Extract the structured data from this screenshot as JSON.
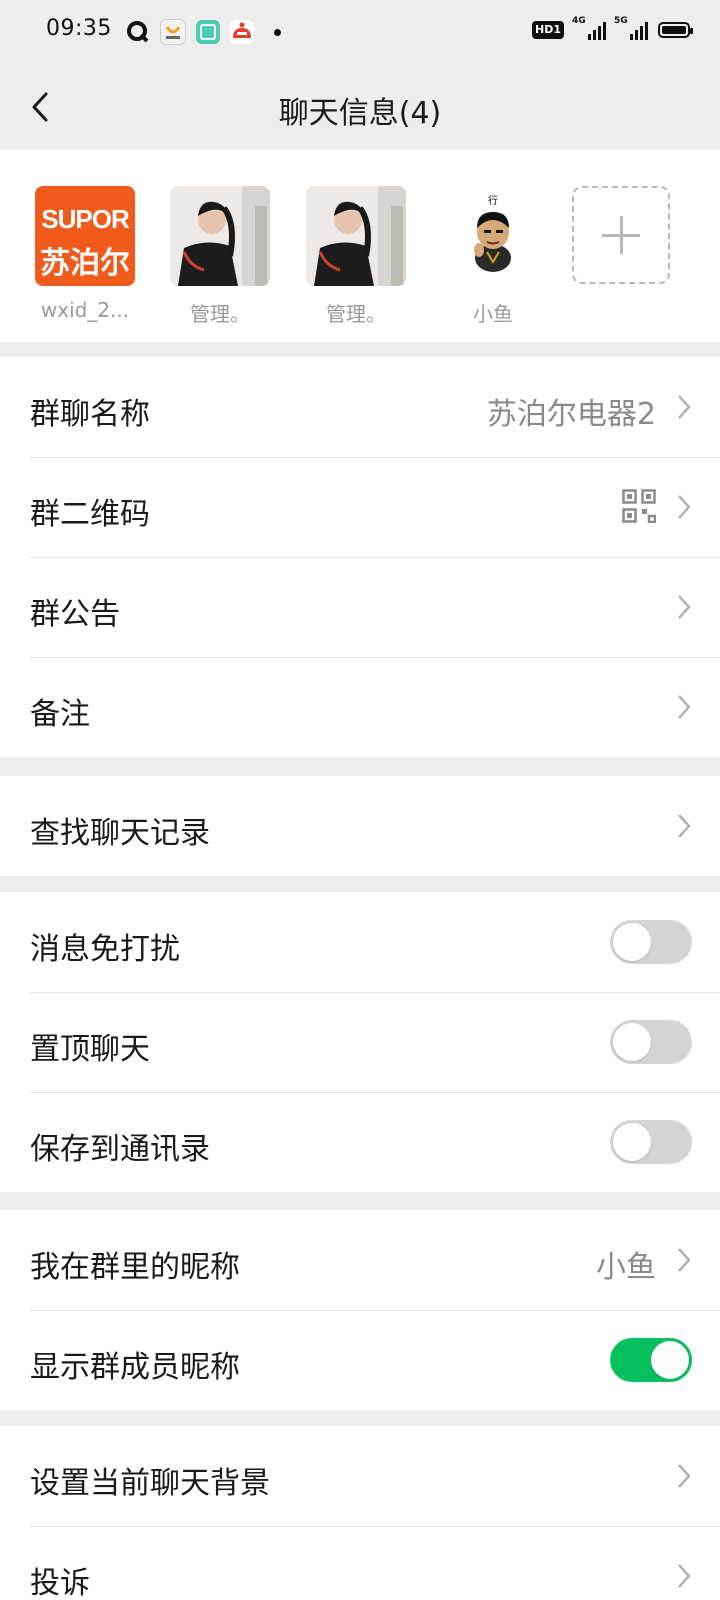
{
  "status_bar": {
    "time": "09:35",
    "hd_badge": "HD1",
    "net1": "4G",
    "net2": "5G",
    "app_icons": [
      "q-app-icon",
      "brand-app-icon",
      "green-app-icon",
      "red-app-icon"
    ]
  },
  "header": {
    "title": "聊天信息(4)",
    "back_icon": "chevron-left-icon"
  },
  "members": [
    {
      "name": "wxid_2...",
      "avatar": "supor-logo-avatar",
      "avatar_text_top": "SUPOR",
      "avatar_text_bottom": "苏泊尔"
    },
    {
      "name": "管理。",
      "avatar": "photo-avatar"
    },
    {
      "name": "管理。",
      "avatar": "photo-avatar"
    },
    {
      "name": "小鱼",
      "avatar": "cartoon-avatar",
      "avatar_caption": "行"
    }
  ],
  "add_member_icon": "plus-icon",
  "section1": {
    "group_name_label": "群聊名称",
    "group_name_value": "苏泊尔电器2",
    "qr_label": "群二维码",
    "notice_label": "群公告",
    "remark_label": "备注"
  },
  "section2": {
    "search_label": "查找聊天记录"
  },
  "section3": {
    "mute_label": "消息免打扰",
    "mute_on": false,
    "pin_label": "置顶聊天",
    "pin_on": false,
    "save_label": "保存到通讯录",
    "save_on": false
  },
  "section4": {
    "my_nick_label": "我在群里的昵称",
    "my_nick_value": "小鱼",
    "show_nick_label": "显示群成员昵称",
    "show_nick_on": true
  },
  "section5": {
    "bg_label": "设置当前聊天背景",
    "complain_label": "投诉"
  },
  "colors": {
    "toggle_on": "#07c160",
    "toggle_off": "#d4d4d4",
    "brand_orange": "#f05a1a"
  }
}
